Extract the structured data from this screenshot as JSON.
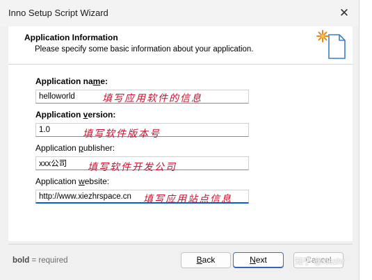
{
  "window": {
    "title": "Inno Setup Script Wizard",
    "close_glyph": "✕"
  },
  "header": {
    "title": "Application Information",
    "subtitle": "Please specify some basic information about your application.",
    "icon": "wizard-document-sparkle-icon"
  },
  "fields": [
    {
      "label_pre": "Application na",
      "label_key": "m",
      "label_post": "e:",
      "bold": true,
      "value": "helloworld",
      "annotation": "填写应用软件的信息"
    },
    {
      "label_pre": "Application ",
      "label_key": "v",
      "label_post": "ersion:",
      "bold": true,
      "value": "1.0",
      "annotation": "填写软件版本号"
    },
    {
      "label_pre": "Application ",
      "label_key": "p",
      "label_post": "ublisher:",
      "bold": false,
      "value": "xxx公司",
      "annotation": "填写软件开发公司"
    },
    {
      "label_pre": "Application ",
      "label_key": "w",
      "label_post": "ebsite:",
      "bold": false,
      "value": "http://www.xiezhrspace.cn",
      "annotation": "填写应用站点信息"
    }
  ],
  "footer": {
    "note_bold": "bold",
    "note_rest": " = required",
    "back_key": "B",
    "back_rest": "ack",
    "next_key": "N",
    "next_rest": "ext",
    "cancel_label": "Cancel"
  },
  "watermark": "知乎 @xiezhr",
  "colors": {
    "annotation": "#c8102e",
    "focus_accent": "#0a5bd1",
    "window_bg": "#f0f0f0"
  }
}
